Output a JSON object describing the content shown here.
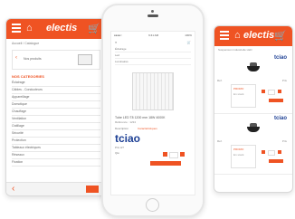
{
  "left_screen": {
    "app_logo": "electis",
    "home_glyph": "⌂",
    "cart_glyph": "🛒",
    "breadcrumb": "Accueil / Catalogue",
    "promo_title": "Nos produits",
    "promo_arrow": "‹",
    "section_title": "NOS CATEGORIES",
    "categories": [
      "Éclairage",
      "Câbles - Conducteurs",
      "Appareillage",
      "Domotique",
      "Chauffage",
      "Ventilation",
      "Outillage",
      "Sécurité",
      "Protection",
      "Tableaux électriques",
      "Réseaux",
      "Fixation"
    ],
    "back_glyph": "‹"
  },
  "middle_screen": {
    "status_left": "●●●●○",
    "status_center": "9:41 AM",
    "status_right": "100%",
    "menu_glyph": "≡",
    "cart_glyph": "🛒",
    "rows": [
      "Éclairage",
      "Led",
      "Luminaires"
    ],
    "product_title": "Tube LED T8 1200 mm 18W 4000K",
    "product_ref": "Référence : 1234",
    "tab_1": "Description",
    "tab_2": "Caractéristiques",
    "brand": "tciao",
    "price_label": "Prix HT",
    "qty_label": "Qté"
  },
  "right_screen": {
    "app_logo": "electis",
    "subtitle": "Suspension industrielle LED",
    "brand": "tciao",
    "cards": [
      {
        "label_left": "Réf.",
        "label_right": "Prix",
        "box_title": "PROMO",
        "box_sub": "En stock"
      },
      {
        "label_left": "Réf.",
        "label_right": "Prix",
        "box_title": "PROMO",
        "box_sub": "En stock"
      }
    ]
  },
  "colors": {
    "accent": "#ef5323",
    "brand_blue": "#1c3f94"
  }
}
